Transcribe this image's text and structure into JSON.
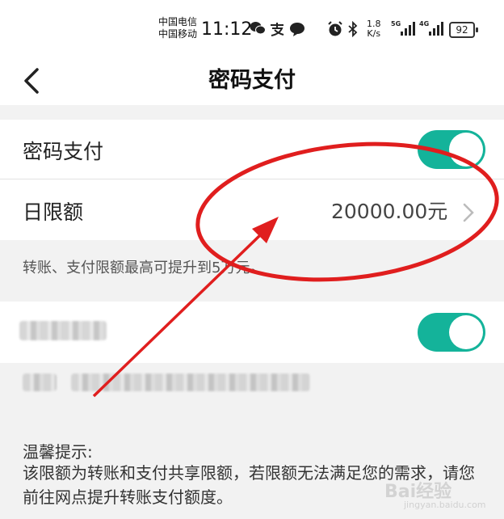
{
  "status_bar": {
    "carrier_1": "中国电信",
    "carrier_2": "中国移动",
    "time": "11:12",
    "net_speed_value": "1.8",
    "net_speed_unit": "K/s",
    "signal_1_label": "5G",
    "signal_2_label": "4G",
    "battery_level": "92",
    "icons": [
      "wechat-icon",
      "alipay-icon",
      "message-icon",
      "alarm-icon",
      "bluetooth-icon",
      "signal-icon",
      "battery-icon"
    ]
  },
  "nav": {
    "title": "密码支付",
    "back_icon": "chevron-left-icon"
  },
  "password_pay": {
    "label": "密码支付",
    "enabled": true
  },
  "daily_limit": {
    "label": "日限额",
    "value": "20000.00元",
    "chevron_icon": "chevron-right-icon"
  },
  "limit_hint": "转账、支付限额最高可提升到5万元。",
  "tips": {
    "title": "温馨提示:",
    "body": "该限额为转账和支付共享限额，若限额无法满足您的需求，请您前往网点提升转账支付额度。"
  },
  "watermark": {
    "text": "Bai经验",
    "sub": "jingyan.baidu.com"
  },
  "colors": {
    "toggle_on": "#14b39a",
    "annotation_red": "#e01e1e",
    "background": "#f2f2f2"
  }
}
